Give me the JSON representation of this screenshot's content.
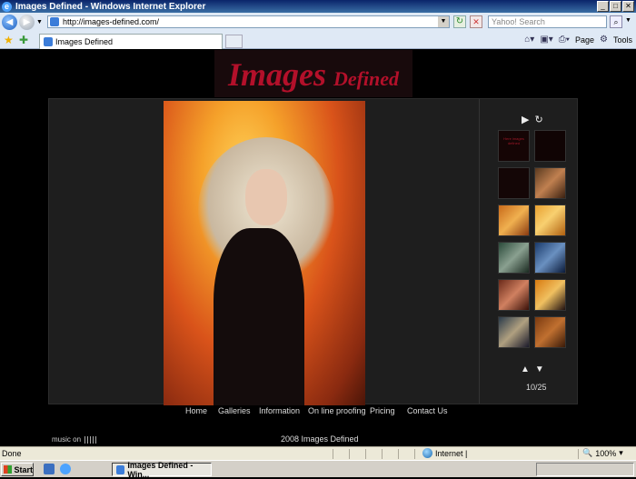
{
  "window": {
    "title": "Images Defined - Windows Internet Explorer",
    "controls": [
      "_",
      "□",
      "✕"
    ]
  },
  "address_bar": {
    "url": "http://images-defined.com/",
    "search_placeholder": "Yahoo! Search"
  },
  "tabs": [
    {
      "label": "Images Defined"
    }
  ],
  "toolbar": {
    "page_label": "Page",
    "tools_label": "Tools"
  },
  "site": {
    "logo_big": "Images",
    "logo_small": "Defined",
    "counter": "10/25",
    "nav": [
      {
        "label": "Home"
      },
      {
        "label": "Galleries"
      },
      {
        "label": "Information"
      },
      {
        "label": "On line proofing"
      },
      {
        "label": "Pricing"
      },
      {
        "label": "Contact Us"
      }
    ],
    "music_label": "music on",
    "copyright": "2008 Images Defined"
  },
  "thumbnails": [
    {
      "text": "Here images defined",
      "icon": "text-thumb"
    },
    {
      "text": "",
      "icon": "text-thumb"
    },
    {
      "text": "",
      "icon": "text-thumb"
    },
    {
      "text": "",
      "icon": "photo-thumb"
    },
    {
      "text": "",
      "icon": "photo-thumb"
    },
    {
      "text": "",
      "icon": "photo-thumb"
    },
    {
      "text": "",
      "icon": "photo-thumb"
    },
    {
      "text": "",
      "icon": "photo-thumb"
    },
    {
      "text": "",
      "icon": "photo-thumb"
    },
    {
      "text": "",
      "icon": "photo-thumb"
    },
    {
      "text": "",
      "icon": "photo-thumb"
    },
    {
      "text": "",
      "icon": "photo-thumb"
    }
  ],
  "status_bar": {
    "status": "Done",
    "zone": "Internet |",
    "zoom": "100%"
  },
  "taskbar": {
    "start_label": "Start",
    "task_label": "Images Defined - Win..."
  },
  "colors": {
    "logo_red": "#b3102a",
    "page_bg": "#000000",
    "stage_bg": "#1e1e1e"
  }
}
